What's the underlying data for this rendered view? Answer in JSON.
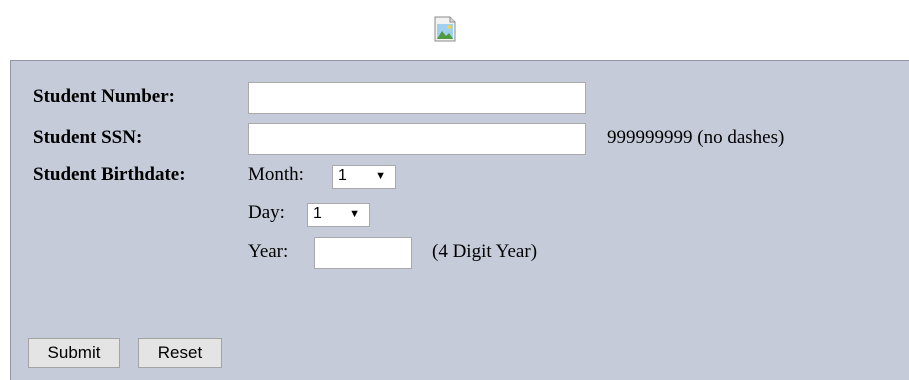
{
  "header": {
    "logo_icon": "broken-image-icon"
  },
  "form": {
    "student_number_label": "Student Number:",
    "student_number_value": "",
    "student_ssn_label": "Student SSN:",
    "student_ssn_value": "",
    "ssn_hint": "999999999 (no dashes)",
    "birthdate_label": "Student Birthdate:",
    "month_label": "Month:",
    "month_value": "1",
    "day_label": "Day:",
    "day_value": "1",
    "year_label": "Year:",
    "year_value": "",
    "year_hint": "(4 Digit Year)",
    "dropdown_arrow": "▼"
  },
  "actions": {
    "submit_label": "Submit",
    "reset_label": "Reset"
  }
}
